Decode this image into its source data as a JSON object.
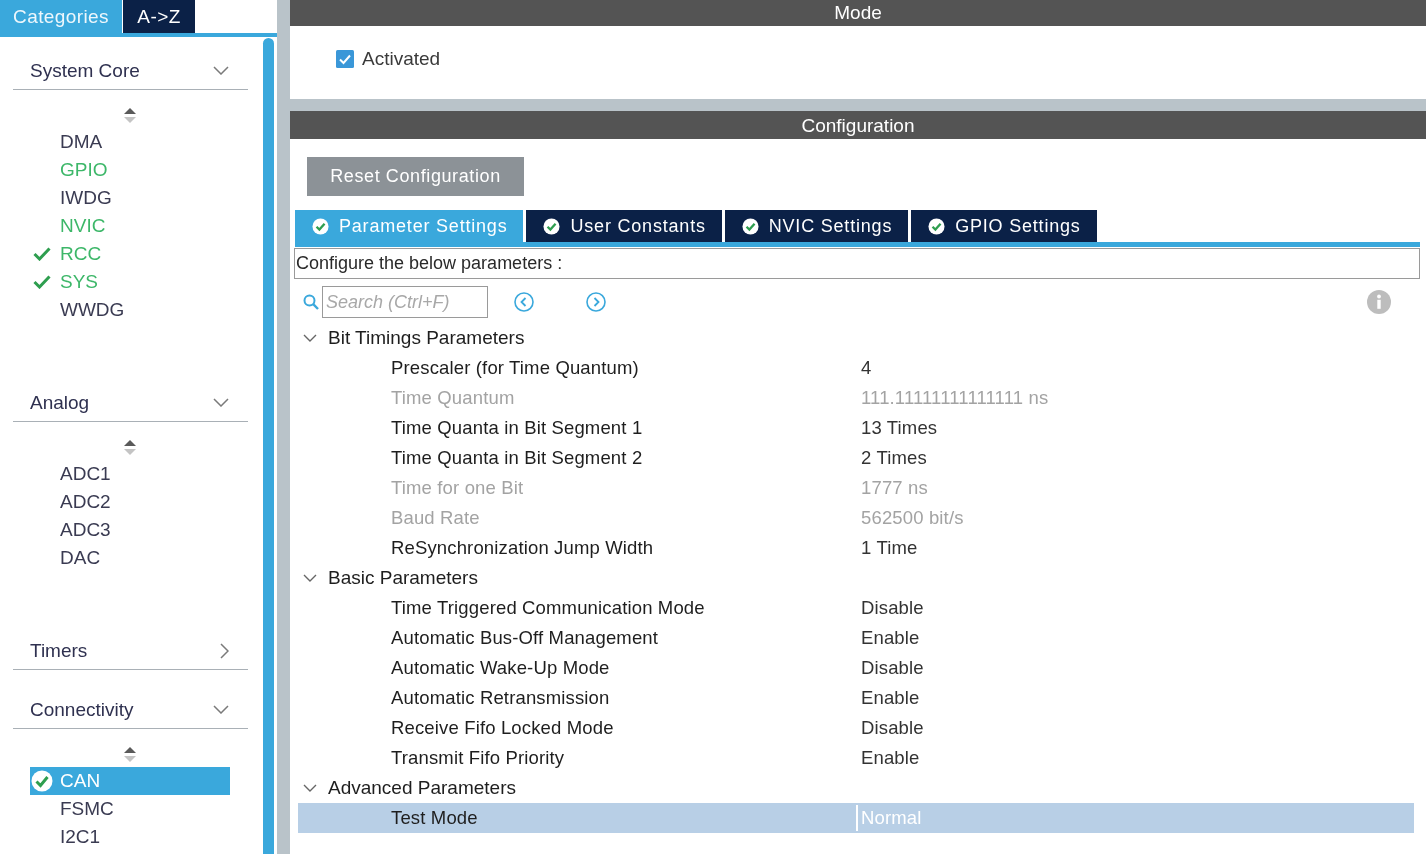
{
  "sidebar": {
    "tabs": [
      {
        "label": "Categories",
        "selected": true
      },
      {
        "label": "A->Z",
        "selected": false
      }
    ],
    "categories": [
      {
        "name": "System Core",
        "expanded": true,
        "items": [
          {
            "label": "DMA",
            "configured": false,
            "checked": false,
            "selected": false
          },
          {
            "label": "GPIO",
            "configured": true,
            "checked": false,
            "selected": false
          },
          {
            "label": "IWDG",
            "configured": false,
            "checked": false,
            "selected": false
          },
          {
            "label": "NVIC",
            "configured": true,
            "checked": false,
            "selected": false
          },
          {
            "label": "RCC",
            "configured": true,
            "checked": true,
            "selected": false
          },
          {
            "label": "SYS",
            "configured": true,
            "checked": true,
            "selected": false
          },
          {
            "label": "WWDG",
            "configured": false,
            "checked": false,
            "selected": false
          }
        ]
      },
      {
        "name": "Analog",
        "expanded": true,
        "items": [
          {
            "label": "ADC1",
            "configured": false,
            "checked": false,
            "selected": false
          },
          {
            "label": "ADC2",
            "configured": false,
            "checked": false,
            "selected": false
          },
          {
            "label": "ADC3",
            "configured": false,
            "checked": false,
            "selected": false
          },
          {
            "label": "DAC",
            "configured": false,
            "checked": false,
            "selected": false
          }
        ]
      },
      {
        "name": "Timers",
        "expanded": false
      },
      {
        "name": "Connectivity",
        "expanded": true,
        "items": [
          {
            "label": "CAN",
            "configured": true,
            "checked": true,
            "selected": true
          },
          {
            "label": "FSMC",
            "configured": false,
            "checked": false,
            "selected": false
          },
          {
            "label": "I2C1",
            "configured": false,
            "checked": false,
            "selected": false
          }
        ]
      }
    ]
  },
  "mode": {
    "title": "Mode",
    "activated": {
      "label": "Activated",
      "checked": true
    }
  },
  "configuration": {
    "title": "Configuration",
    "reset_button": "Reset Configuration",
    "tabs": [
      {
        "label": "Parameter Settings",
        "selected": true
      },
      {
        "label": "User Constants",
        "selected": false
      },
      {
        "label": "NVIC Settings",
        "selected": false
      },
      {
        "label": "GPIO Settings",
        "selected": false
      }
    ],
    "description": "Configure the below parameters :",
    "search": {
      "placeholder": "Search (Ctrl+F)"
    },
    "groups": [
      {
        "name": "Bit Timings Parameters",
        "expanded": true,
        "params": [
          {
            "name": "Prescaler (for Time Quantum)",
            "value": "4",
            "disabled": false,
            "selected": false
          },
          {
            "name": "Time Quantum",
            "value": "111.11111111111111 ns",
            "disabled": true,
            "selected": false
          },
          {
            "name": "Time Quanta in Bit Segment 1",
            "value": "13 Times",
            "disabled": false,
            "selected": false
          },
          {
            "name": "Time Quanta in Bit Segment 2",
            "value": "2 Times",
            "disabled": false,
            "selected": false
          },
          {
            "name": "Time for one Bit",
            "value": "1777 ns",
            "disabled": true,
            "selected": false
          },
          {
            "name": "Baud Rate",
            "value": "562500 bit/s",
            "disabled": true,
            "selected": false
          },
          {
            "name": "ReSynchronization Jump Width",
            "value": "1 Time",
            "disabled": false,
            "selected": false
          }
        ]
      },
      {
        "name": "Basic Parameters",
        "expanded": true,
        "params": [
          {
            "name": "Time Triggered Communication Mode",
            "value": "Disable",
            "disabled": false,
            "selected": false
          },
          {
            "name": "Automatic Bus-Off Management",
            "value": "Enable",
            "disabled": false,
            "selected": false
          },
          {
            "name": "Automatic Wake-Up Mode",
            "value": "Disable",
            "disabled": false,
            "selected": false
          },
          {
            "name": "Automatic Retransmission",
            "value": "Enable",
            "disabled": false,
            "selected": false
          },
          {
            "name": "Receive Fifo Locked Mode",
            "value": "Disable",
            "disabled": false,
            "selected": false
          },
          {
            "name": "Transmit Fifo Priority",
            "value": "Enable",
            "disabled": false,
            "selected": false
          }
        ]
      },
      {
        "name": "Advanced Parameters",
        "expanded": true,
        "params": [
          {
            "name": "Test Mode",
            "value": "Normal",
            "disabled": false,
            "selected": true
          }
        ]
      }
    ]
  }
}
